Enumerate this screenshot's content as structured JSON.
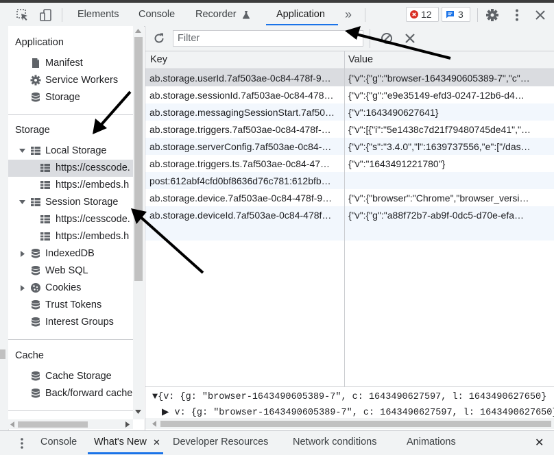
{
  "toolbar": {
    "tabs": [
      {
        "label": "Elements"
      },
      {
        "label": "Console"
      },
      {
        "label": "Recorder"
      },
      {
        "label": "Application"
      }
    ],
    "active_tab": "Application",
    "more_tabs_glyph": "»",
    "error_count": "12",
    "message_count": "3",
    "icons": [
      "inspect-element-icon",
      "device-toolbar-icon",
      "recorder-flask-icon",
      "error-icon",
      "message-icon",
      "settings-gear-icon",
      "more-vert-icon",
      "close-icon"
    ]
  },
  "sidebar": {
    "application_title": "Application",
    "application_items": [
      {
        "label": "Manifest",
        "icon": "document-icon"
      },
      {
        "label": "Service Workers",
        "icon": "gear-icon"
      },
      {
        "label": "Storage",
        "icon": "database-icon"
      }
    ],
    "storage_title": "Storage",
    "storage_items": [
      {
        "label": "Local Storage",
        "icon": "grid-icon",
        "expanded": true
      },
      {
        "label": "https://cesscode.",
        "icon": "grid-icon",
        "selected": true
      },
      {
        "label": "https://embeds.h",
        "icon": "grid-icon"
      },
      {
        "label": "Session Storage",
        "icon": "grid-icon",
        "expanded": true
      },
      {
        "label": "https://cesscode.",
        "icon": "grid-icon"
      },
      {
        "label": "https://embeds.h",
        "icon": "grid-icon"
      },
      {
        "label": "IndexedDB",
        "icon": "database-icon",
        "expanded": false
      },
      {
        "label": "Web SQL",
        "icon": "database-icon"
      },
      {
        "label": "Cookies",
        "icon": "cookie-icon",
        "expanded": false
      },
      {
        "label": "Trust Tokens",
        "icon": "database-icon"
      },
      {
        "label": "Interest Groups",
        "icon": "database-icon"
      }
    ],
    "cache_title": "Cache",
    "cache_items": [
      {
        "label": "Cache Storage",
        "icon": "database-icon"
      },
      {
        "label": "Back/forward cache",
        "icon": "database-icon"
      }
    ]
  },
  "main": {
    "filter_placeholder": "Filter",
    "columns": {
      "key": "Key",
      "value": "Value"
    },
    "rows": [
      {
        "key": "ab.storage.userId.7af503ae-0c84-478f-9…",
        "value": "{\"v\":{\"g\":\"browser-1643490605389-7\",\"c\"…"
      },
      {
        "key": "ab.storage.sessionId.7af503ae-0c84-478…",
        "value": "{\"v\":{\"g\":\"e9e35149-efd3-0247-12b6-d4…"
      },
      {
        "key": "ab.storage.messagingSessionStart.7af50…",
        "value": "{\"v\":1643490627641}"
      },
      {
        "key": "ab.storage.triggers.7af503ae-0c84-478f-…",
        "value": "{\"v\":[{\"i\":\"5e1438c7d21f79480745de41\",\"…"
      },
      {
        "key": "ab.storage.serverConfig.7af503ae-0c84-…",
        "value": "{\"v\":{\"s\":\"3.4.0\",\"l\":1639737556,\"e\":[\"/das…"
      },
      {
        "key": "ab.storage.triggers.ts.7af503ae-0c84-47…",
        "value": "{\"v\":\"1643491221780\"}"
      },
      {
        "key": "post:612abf4cfd0bf8636d76c781:612bfb…",
        "value": ""
      },
      {
        "key": "ab.storage.device.7af503ae-0c84-478f-9…",
        "value": "{\"v\":{\"browser\":\"Chrome\",\"browser_versi…"
      },
      {
        "key": "ab.storage.deviceId.7af503ae-0c84-478f…",
        "value": "{\"v\":{\"g\":\"a88f72b7-ab9f-0dc5-d70e-efa…"
      }
    ],
    "preview": {
      "line1": "▼{v: {g: \"browser-1643490605389-7\", c: 1643490627597, l: 1643490627650}",
      "line2": "▶ v: {g: \"browser-1643490605389-7\", c: 1643490627597, l: 1643490627650}"
    }
  },
  "drawer": {
    "tabs": [
      {
        "label": "Console"
      },
      {
        "label": "What's New"
      },
      {
        "label": "Developer Resources"
      },
      {
        "label": "Network conditions"
      },
      {
        "label": "Animations"
      }
    ],
    "active_tab": "What's New",
    "tab_close_glyph": "✕",
    "drawer_close_glyph": "✕"
  },
  "colors": {
    "accent": "#1a73e8",
    "error_red": "#d93025",
    "selected_row": "#dadce0",
    "annotation_arrow": "#000000"
  }
}
